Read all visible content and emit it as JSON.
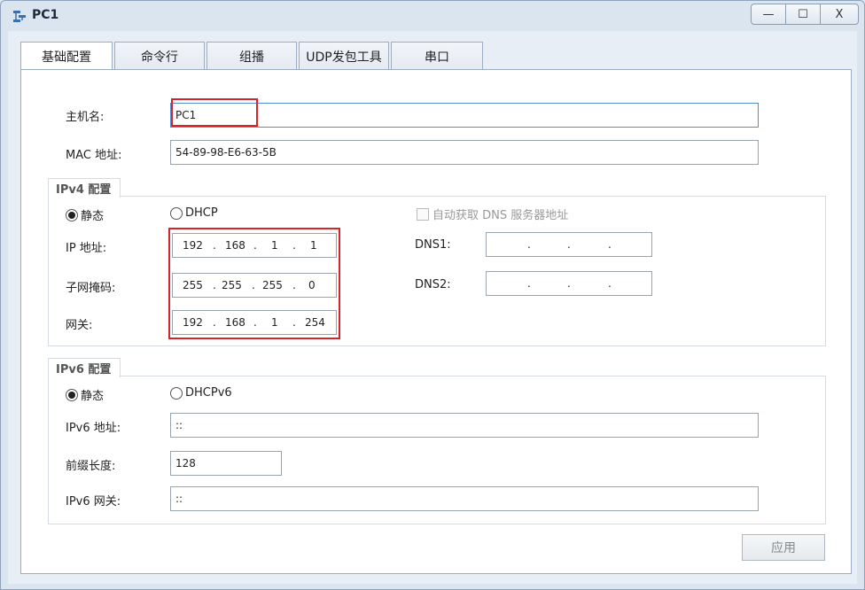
{
  "window": {
    "title": "PC1",
    "controls": {
      "minimize": "—",
      "maximize": "☐",
      "close": "X"
    }
  },
  "tabs": [
    {
      "label": "基础配置",
      "active": true
    },
    {
      "label": "命令行",
      "active": false
    },
    {
      "label": "组播",
      "active": false
    },
    {
      "label": "UDP发包工具",
      "active": false
    },
    {
      "label": "串口",
      "active": false
    }
  ],
  "basic": {
    "hostname_label": "主机名:",
    "hostname_value": "PC1",
    "mac_label": "MAC 地址:",
    "mac_value": "54-89-98-E6-63-5B"
  },
  "ipv4": {
    "title": "IPv4 配置",
    "static_label": "静态",
    "static_selected": true,
    "dhcp_label": "DHCP",
    "dhcp_selected": false,
    "auto_dns_label": "自动获取 DNS 服务器地址",
    "auto_dns_checked": false,
    "ip_label": "IP 地址:",
    "ip": [
      "192",
      "168",
      "1",
      "1"
    ],
    "mask_label": "子网掩码:",
    "mask": [
      "255",
      "255",
      "255",
      "0"
    ],
    "gateway_label": "网关:",
    "gateway": [
      "192",
      "168",
      "1",
      "254"
    ],
    "dns1_label": "DNS1:",
    "dns1": [
      "",
      "",
      "",
      ""
    ],
    "dns2_label": "DNS2:",
    "dns2": [
      "",
      "",
      "",
      ""
    ],
    "dot": "."
  },
  "ipv6": {
    "title": "IPv6 配置",
    "static_label": "静态",
    "static_selected": true,
    "dhcp_label": "DHCPv6",
    "dhcp_selected": false,
    "address_label": "IPv6 地址:",
    "address_value": "::",
    "prefix_label": "前缀长度:",
    "prefix_value": "128",
    "gateway_label": "IPv6 网关:",
    "gateway_value": "::"
  },
  "apply_label": "应用",
  "colors": {
    "highlight": "#d6242b",
    "focus": "#4f8fcf"
  }
}
